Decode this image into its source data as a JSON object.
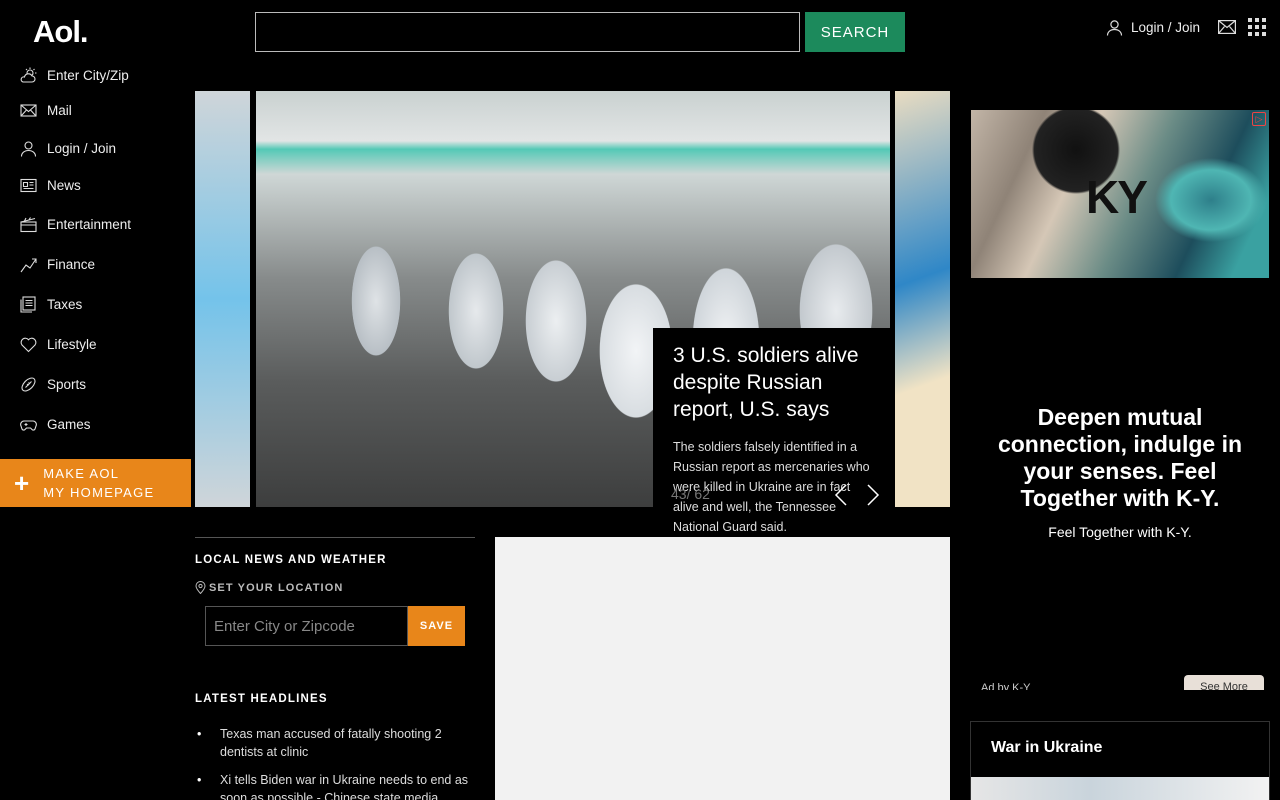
{
  "header": {
    "logo": "Aol.",
    "search_placeholder": "",
    "search_label": "SEARCH",
    "login_label": "Login / Join"
  },
  "sidebar": {
    "items": [
      {
        "label": "Enter City/Zip",
        "icon": "weather-icon"
      },
      {
        "label": "Mail",
        "icon": "mail-icon"
      },
      {
        "label": "Login / Join",
        "icon": "user-icon"
      },
      {
        "label": "News",
        "icon": "news-icon"
      },
      {
        "label": "Entertainment",
        "icon": "clapper-icon"
      },
      {
        "label": "Finance",
        "icon": "chart-icon"
      },
      {
        "label": "Taxes",
        "icon": "document-icon"
      },
      {
        "label": "Lifestyle",
        "icon": "heart-icon"
      },
      {
        "label": "Sports",
        "icon": "football-icon"
      },
      {
        "label": "Games",
        "icon": "gamepad-icon"
      }
    ],
    "homepage_line1": "MAKE AOL",
    "homepage_line2": "MY HOMEPAGE"
  },
  "hero": {
    "title": "3 U.S. soldiers alive despite Russian report, U.S. says",
    "summary": "The soldiers falsely identified in a Russian report as mercenaries who were killed in Ukraine are in fact alive and well, the Tennessee National Guard said.",
    "counter": "43/ 62"
  },
  "local": {
    "title": "LOCAL NEWS AND WEATHER",
    "set_location": "SET YOUR LOCATION",
    "input_placeholder": "Enter City or Zipcode",
    "save_label": "SAVE"
  },
  "headlines": {
    "title": "LATEST HEADLINES",
    "items": [
      "Texas man accused of fatally shooting 2 dentists at clinic",
      "Xi tells Biden war in Ukraine needs to end as soon as possible - Chinese state media"
    ]
  },
  "ad": {
    "logo": "KY",
    "headline": "Deepen mutual connection, indulge in your senses. Feel Together with K-Y.",
    "subline": "Feel Together with K-Y.",
    "by": "Ad by K-Y",
    "see_more": "See More"
  },
  "ukraine": {
    "title": "War in Ukraine"
  },
  "colors": {
    "accent_orange": "#e8861a",
    "search_green": "#1c8a5c"
  }
}
